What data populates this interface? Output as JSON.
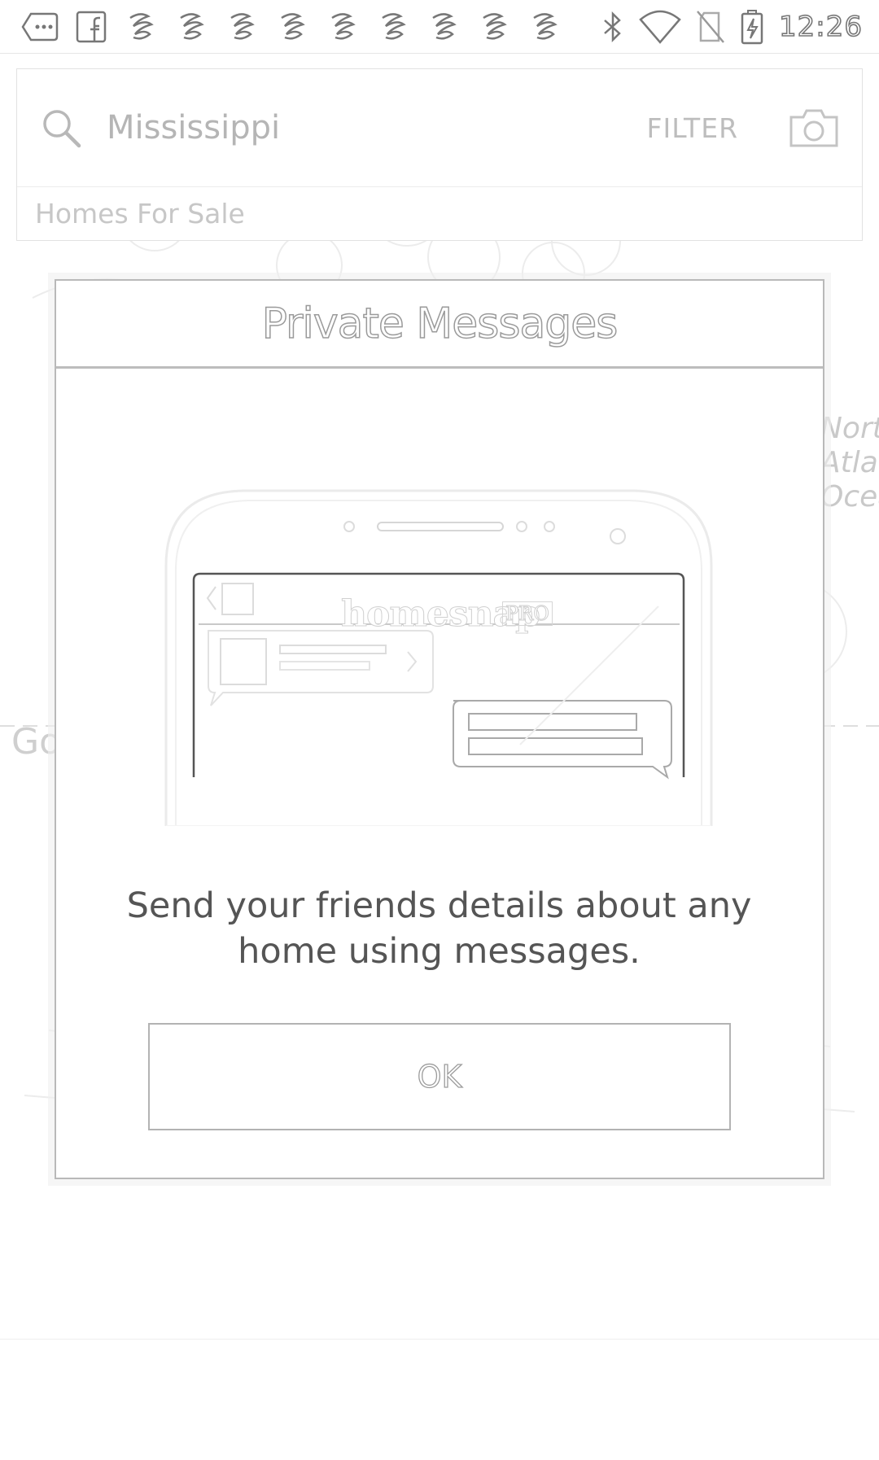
{
  "status_bar": {
    "time": "12:26",
    "left_icons": [
      "more-messages-icon",
      "facebook-icon",
      "app-notification-icon",
      "app-notification-icon",
      "app-notification-icon",
      "app-notification-icon",
      "app-notification-icon",
      "app-notification-icon",
      "app-notification-icon",
      "app-notification-icon",
      "app-notification-icon"
    ],
    "right_icons": [
      "bluetooth-icon",
      "wifi-icon",
      "no-sim-icon",
      "battery-charging-icon"
    ]
  },
  "search": {
    "query": "Mississippi",
    "filter_label": "FILTER",
    "category": "Homes For Sale"
  },
  "map": {
    "ocean_label": [
      "Nort",
      "Atlan",
      "Ocea"
    ],
    "google_logo": "Go"
  },
  "dialog": {
    "title": "Private Messages",
    "illustration_brand": "homesnap",
    "illustration_badge": "PRO",
    "body": "Send your friends details about any home using messages.",
    "ok_label": "OK"
  }
}
